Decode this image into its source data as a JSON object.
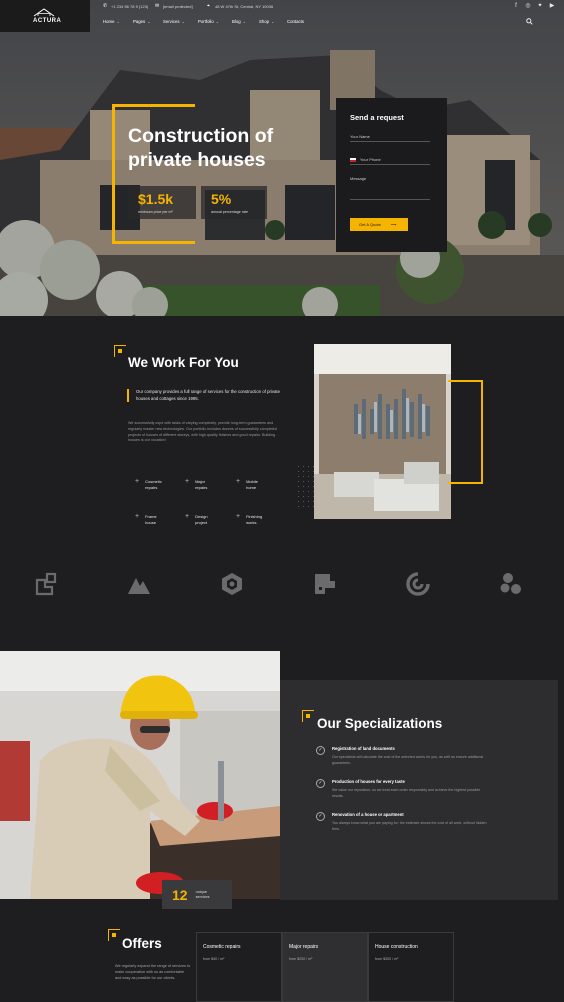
{
  "brand": {
    "logo_text": "ACTURA"
  },
  "header": {
    "phone": "+1 234 56 78 9 (123)",
    "email": "[email protected]",
    "address": "48 W 47th St, Central, NY 10036",
    "nav": [
      {
        "label": "Home",
        "has_dropdown": true
      },
      {
        "label": "Pages",
        "has_dropdown": true
      },
      {
        "label": "Services",
        "has_dropdown": true
      },
      {
        "label": "Portfolio",
        "has_dropdown": true
      },
      {
        "label": "Blog",
        "has_dropdown": true
      },
      {
        "label": "Shop",
        "has_dropdown": true
      },
      {
        "label": "Contacts",
        "has_dropdown": false
      }
    ],
    "socials": [
      "facebook-icon",
      "instagram-icon",
      "twitter-icon",
      "youtube-icon"
    ]
  },
  "hero": {
    "title_line1": "Construction of",
    "title_line2": "private houses",
    "stats": [
      {
        "value": "$1.5k",
        "label": "minimum price per m²"
      },
      {
        "value": "5%",
        "label": "annual percentage rate"
      }
    ]
  },
  "request_form": {
    "title": "Send a request",
    "name_placeholder": "Your Name",
    "phone_placeholder": "Your Phone",
    "message_placeholder": "Message",
    "button_label": "Get A Quote",
    "button_arrow": "⟶"
  },
  "work": {
    "title": "We Work For You",
    "lead": "Our company provides a full range of services for the construction of private houses and cottages since 1995.",
    "text": "We successfully cope with tasks of varying complexity, provide long-term guarantees and regularly master new technologies. Our portfolio includes dozens of successfully completed projects of houses of different storeys, with high-quality finishes and good repairs. Building houses is our vocation!",
    "services": [
      {
        "line1": "Cosmetic",
        "line2": "repairs"
      },
      {
        "line1": "Major",
        "line2": "repairs"
      },
      {
        "line1": "Mobile",
        "line2": "home"
      },
      {
        "line1": "Frame",
        "line2": "house"
      },
      {
        "line1": "Design",
        "line2": "project"
      },
      {
        "line1": "Finishing",
        "line2": "works"
      }
    ]
  },
  "partners": [
    "squares-logo-icon",
    "mountain-logo-icon",
    "hexagon-logo-icon",
    "block-logo-icon",
    "swirl-logo-icon",
    "molecule-logo-icon"
  ],
  "specializations": {
    "title": "Our Specializations",
    "items": [
      {
        "title": "Registration of land documents",
        "text": "Our specialists will calculate the cost of the selected works for you, as well as ensure additional guarantees."
      },
      {
        "title": "Production of houses for every taste",
        "text": "We value our reputation, so we treat each order responsibly and achieve the highest possible results."
      },
      {
        "title": "Renovation of a house or apartment",
        "text": "You always know what you are paying for: the estimate shows the cost of all work, without hidden fees."
      }
    ],
    "counter_value": "12",
    "counter_label": "unique services"
  },
  "offers": {
    "title": "Offers",
    "text": "We regularly expand the range of services to make cooperation with us as comfortable and easy as possible for our clients.",
    "items": [
      {
        "name": "Cosmetic repairs",
        "price": "from $40 / m²"
      },
      {
        "name": "Major repairs",
        "price": "from $200 / m²"
      },
      {
        "name": "House construction",
        "price": "from $300 / m²"
      }
    ]
  },
  "colors": {
    "accent": "#f5b400",
    "background": "#1e1e20",
    "panel": "#2d2d2f"
  }
}
